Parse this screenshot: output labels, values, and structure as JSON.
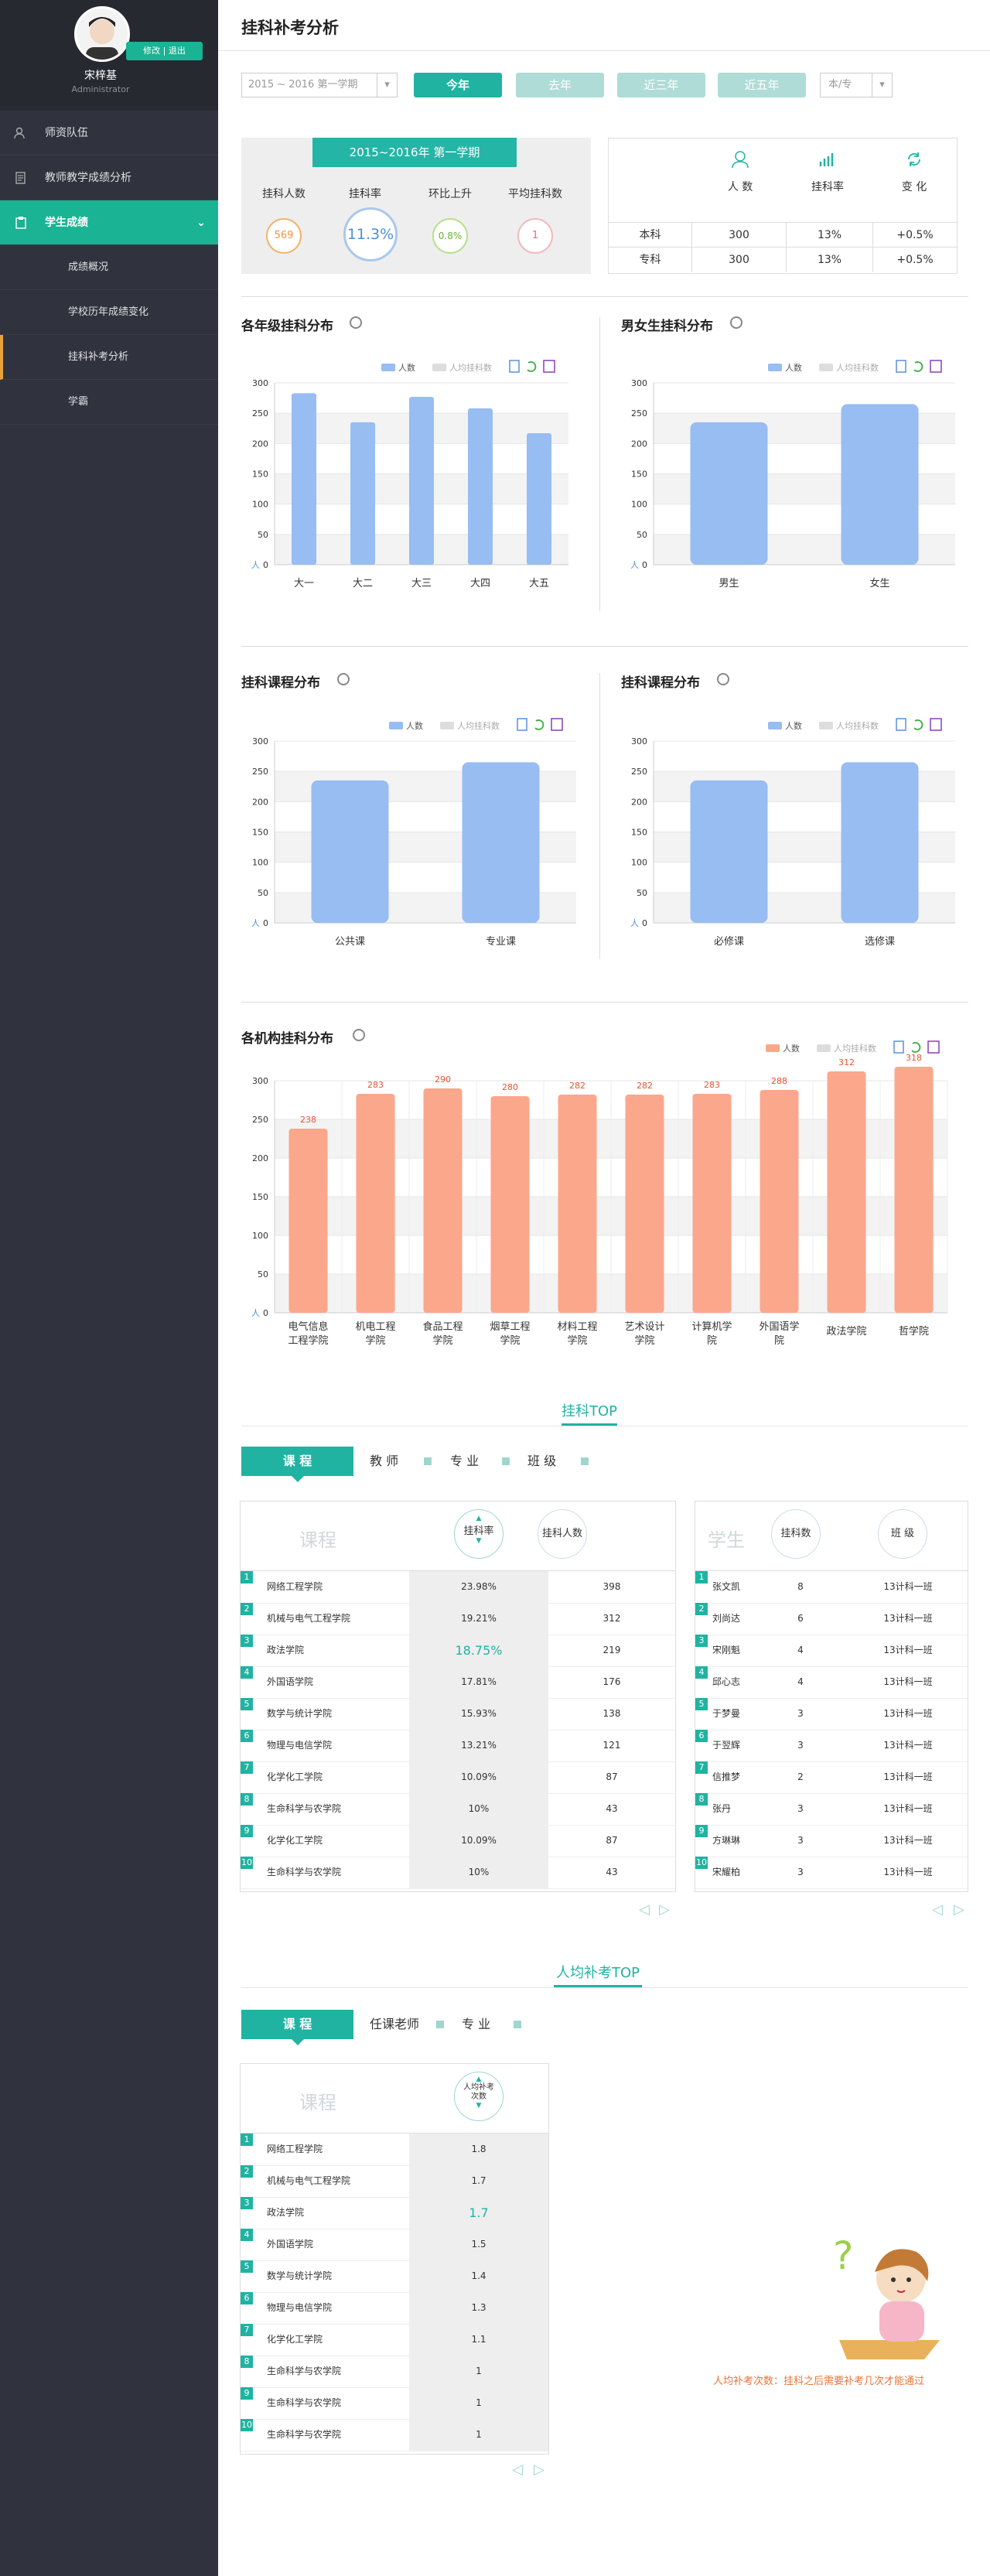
{
  "user": {
    "name": "宋梓基",
    "role": "Administrator",
    "action": "修改 | 退出"
  },
  "sidebar": {
    "items": [
      {
        "label": "师资队伍"
      },
      {
        "label": "教师教学成绩分析"
      },
      {
        "label": "学生成绩"
      }
    ],
    "sub": [
      {
        "label": "成绩概况"
      },
      {
        "label": "学校历年成绩变化"
      },
      {
        "label": "挂科补考分析"
      },
      {
        "label": "学霸"
      }
    ]
  },
  "header": {
    "title": "挂科补考分析"
  },
  "filters": {
    "term": "2015 ~ 2016 第一学期",
    "buttons": [
      "今年",
      "去年",
      "近三年",
      "近五年"
    ],
    "major": "本/专"
  },
  "stats": {
    "banner": "2015~2016年 第一学期",
    "labels": [
      "挂科人数",
      "挂科率",
      "环比上升",
      "平均挂科数"
    ],
    "values": [
      "569",
      "11.3%",
      "0.8%",
      "1"
    ],
    "right_headers": [
      "人 数",
      "挂科率",
      "变 化"
    ],
    "rows": [
      {
        "name": "本科",
        "count": "300",
        "rate": "13%",
        "change": "+0.5%"
      },
      {
        "name": "专科",
        "count": "300",
        "rate": "13%",
        "change": "+0.5%"
      }
    ]
  },
  "legend": {
    "count": "人数",
    "avg": "人均挂科数"
  },
  "charts": {
    "grade": {
      "title": "各年级挂科分布",
      "categories": [
        "大一",
        "大二",
        "大三",
        "大四",
        "大五"
      ],
      "values": [
        283,
        235,
        277,
        258,
        217
      ]
    },
    "gender": {
      "title": "男女生挂科分布",
      "categories": [
        "男生",
        "女生"
      ],
      "values": [
        235,
        265
      ]
    },
    "course1": {
      "title": "挂科课程分布",
      "categories": [
        "公共课",
        "专业课"
      ],
      "values": [
        235,
        265
      ]
    },
    "course2": {
      "title": "挂科课程分布",
      "categories": [
        "必修课",
        "选修课"
      ],
      "values": [
        235,
        265
      ]
    },
    "college": {
      "title": "各机构挂科分布",
      "categories": [
        "电气信息工程学院",
        "机电工程学院",
        "食品工程学院",
        "烟草工程学院",
        "材料工程学院",
        "艺术设计学院",
        "计算机学院",
        "外国语学院",
        "政法学院",
        "哲学院"
      ],
      "values": [
        238,
        283,
        290,
        280,
        282,
        282,
        283,
        288,
        312,
        318
      ]
    },
    "ylabels": [
      "300",
      "250",
      "200",
      "150",
      "100",
      "50",
      "0"
    ],
    "yunit": "人"
  },
  "top": {
    "title": "挂科TOP",
    "tabs": [
      "课 程",
      "教 师",
      "专 业",
      "班 级"
    ],
    "course_head": "课程",
    "col_rate": "挂科率",
    "col_count": "挂科人数",
    "rows": [
      {
        "n": "1",
        "name": "网络工程学院",
        "rate": "23.98%",
        "count": "398"
      },
      {
        "n": "2",
        "name": "机械与电气工程学院",
        "rate": "19.21%",
        "count": "312"
      },
      {
        "n": "3",
        "name": "政法学院",
        "rate": "18.75%",
        "count": "219"
      },
      {
        "n": "4",
        "name": "外国语学院",
        "rate": "17.81%",
        "count": "176"
      },
      {
        "n": "5",
        "name": "数学与统计学院",
        "rate": "15.93%",
        "count": "138"
      },
      {
        "n": "6",
        "name": "物理与电信学院",
        "rate": "13.21%",
        "count": "121"
      },
      {
        "n": "7",
        "name": "化学化工学院",
        "rate": "10.09%",
        "count": "87"
      },
      {
        "n": "8",
        "name": "生命科学与农学院",
        "rate": "10%",
        "count": "43"
      },
      {
        "n": "9",
        "name": "化学化工学院",
        "rate": "10.09%",
        "count": "87"
      },
      {
        "n": "10",
        "name": "生命科学与农学院",
        "rate": "10%",
        "count": "43"
      }
    ],
    "student_head": "学生",
    "col_fails": "挂科数",
    "col_class": "班 级",
    "students": [
      {
        "n": "1",
        "name": "张文凯",
        "fails": "8",
        "cls": "13计科一班"
      },
      {
        "n": "2",
        "name": "刘尚达",
        "fails": "6",
        "cls": "13计科一班"
      },
      {
        "n": "3",
        "name": "宋刚魁",
        "fails": "4",
        "cls": "13计科一班"
      },
      {
        "n": "4",
        "name": "邱心志",
        "fails": "4",
        "cls": "13计科一班"
      },
      {
        "n": "5",
        "name": "于梦曼",
        "fails": "3",
        "cls": "13计科一班"
      },
      {
        "n": "6",
        "name": "于翌辉",
        "fails": "3",
        "cls": "13计科一班"
      },
      {
        "n": "7",
        "name": "信推梦",
        "fails": "2",
        "cls": "13计科一班"
      },
      {
        "n": "8",
        "name": "张丹",
        "fails": "3",
        "cls": "13计科一班"
      },
      {
        "n": "9",
        "name": "方琳琳",
        "fails": "3",
        "cls": "13计科一班"
      },
      {
        "n": "10",
        "name": "宋耀柏",
        "fails": "3",
        "cls": "13计科一班"
      }
    ]
  },
  "avg": {
    "title": "人均补考TOP",
    "tabs": [
      "课 程",
      "任课老师",
      "专 业"
    ],
    "course_head": "课程",
    "col": "人均补考次数",
    "rows": [
      {
        "n": "1",
        "name": "网络工程学院",
        "v": "1.8"
      },
      {
        "n": "2",
        "name": "机械与电气工程学院",
        "v": "1.7"
      },
      {
        "n": "3",
        "name": "政法学院",
        "v": "1.7"
      },
      {
        "n": "4",
        "name": "外国语学院",
        "v": "1.5"
      },
      {
        "n": "5",
        "name": "数学与统计学院",
        "v": "1.4"
      },
      {
        "n": "6",
        "name": "物理与电信学院",
        "v": "1.3"
      },
      {
        "n": "7",
        "name": "化学化工学院",
        "v": "1.1"
      },
      {
        "n": "8",
        "name": "生命科学与农学院",
        "v": "1"
      },
      {
        "n": "9",
        "name": "生命科学与农学院",
        "v": "1"
      },
      {
        "n": "10",
        "name": "生命科学与农学院",
        "v": "1"
      }
    ],
    "note": "人均补考次数：挂科之后需要补考几次才能通过"
  }
}
